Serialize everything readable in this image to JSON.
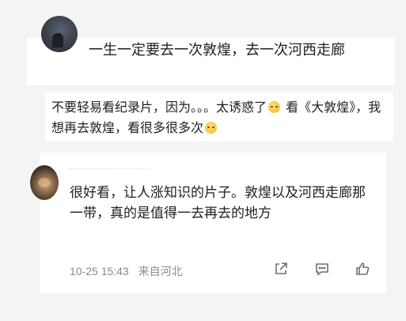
{
  "comments": [
    {
      "text": "一生一定要去一次敦煌，去一次河西走廊"
    },
    {
      "text_part1": "不要轻易看纪录片，因为。。。太诱惑了",
      "text_part2": " 看《大敦煌》，我想再去敦煌，看很多很多次",
      "emoji": "sweat-smile-emoji"
    },
    {
      "text": "很好看，让人涨知识的片子。敦煌以及河西走廊那一带，真的是值得一去再去的地方",
      "date": "10-25 15:43",
      "location": "来自河北",
      "actions": {
        "share_icon": "share-icon",
        "comment_icon": "comment-icon",
        "like_icon": "thumbs-up-icon"
      }
    }
  ]
}
